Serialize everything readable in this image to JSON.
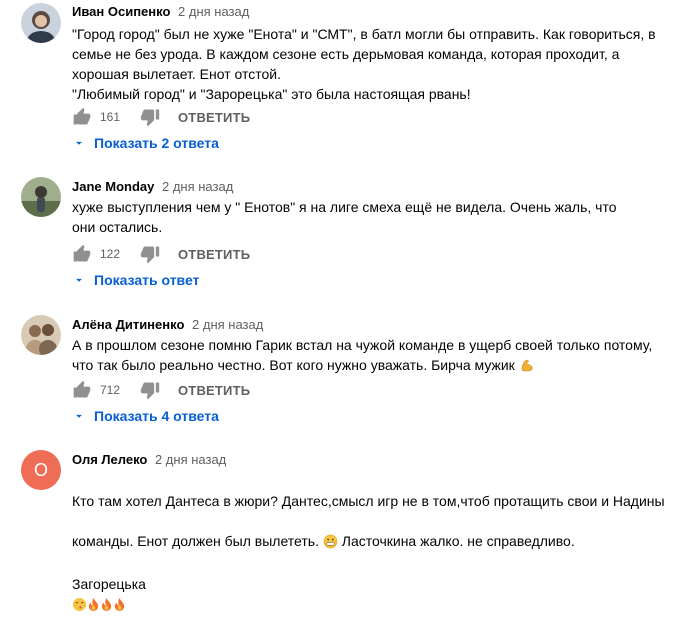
{
  "comments": [
    {
      "author": "Иван Осипенко",
      "time": "2 дня назад",
      "avatar": {
        "type": "photo",
        "color": "#7a8aa0"
      },
      "text": "\"Город город\" был не хуже \"Енота\" и \"СМТ\", в батл могли бы отправить. Как говориться, в семье не без урода. В каждом сезоне есть дерьмовая команда, которая проходит, а хорошая вылетает. Енот отстой.\n\"Любимый город\" и \"Зарорецька\" это была настоящая рвань!",
      "likes": "161",
      "reply_label": "ОТВЕТИТЬ",
      "replies_label": "Показать 2 ответа"
    },
    {
      "author": "Jane Monday",
      "time": "2 дня назад",
      "avatar": {
        "type": "photo",
        "color": "#6e7e5a"
      },
      "text": "хуже выступления чем у \" Енотов\" я на лиге смеха ещё не видела. Очень жаль, что они остались.",
      "likes": "122",
      "reply_label": "ОТВЕТИТЬ",
      "replies_label": "Показать ответ"
    },
    {
      "author": "Алёна Дитиненко",
      "time": "2 дня назад",
      "avatar": {
        "type": "photo",
        "color": "#a08c70"
      },
      "text": "А в прошлом сезоне помню Гарик встал на чужой команде в ущерб своей только потому, что так было реально честно. Вот кого нужно уважать. Бирча мужик",
      "text_emoji": "flexed-biceps",
      "likes": "712",
      "reply_label": "ОТВЕТИТЬ",
      "replies_label": "Показать 4 ответа"
    },
    {
      "author": "Оля Лелеко",
      "time": "2 дня назад",
      "avatar": {
        "type": "letter",
        "letter": "О",
        "color": "#ef6c57"
      },
      "text_line1": "Кто там хотел Дантеса в жюри? Дантес,смысл игр не в том,чтоб протащить свои и Надины",
      "text_line2a": "команды. Енот должен был вылететь.",
      "text_line2b": "Ласточкина жалко. не справедливо.",
      "text_line3": "Загорецька"
    }
  ],
  "colors": {
    "link": "#065fd4",
    "secondary": "#606060"
  }
}
